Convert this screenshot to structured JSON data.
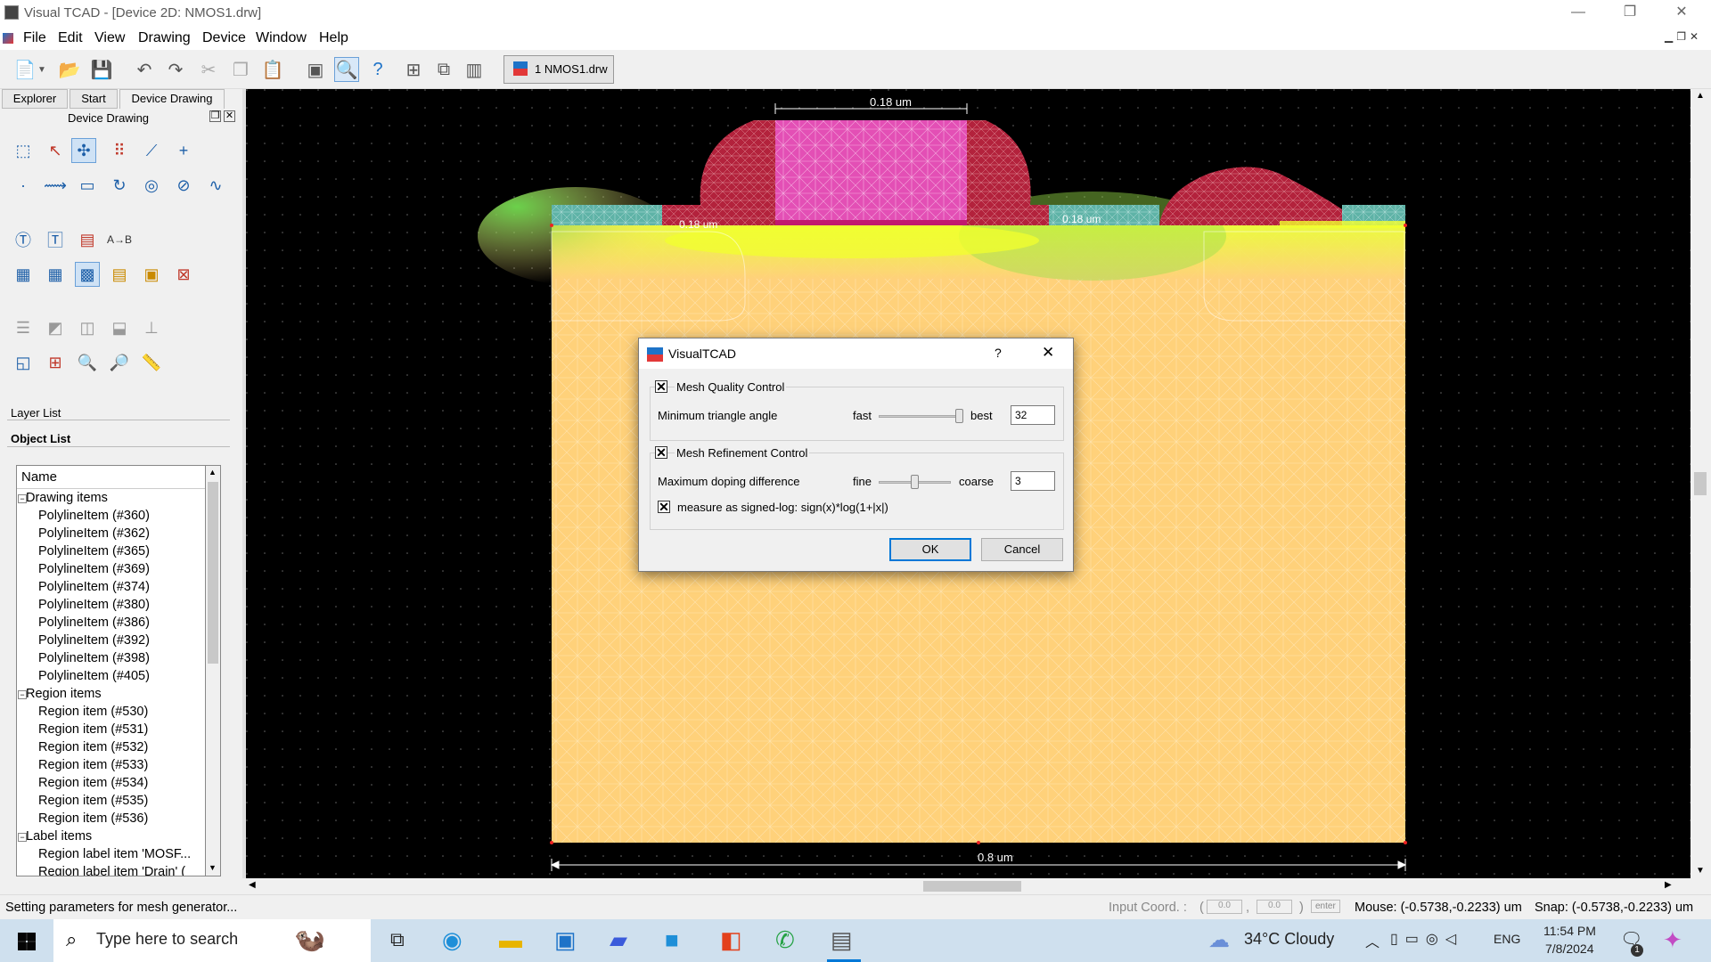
{
  "window": {
    "title": "Visual TCAD - [Device 2D: NMOS1.drw]",
    "controls": {
      "minimize": "—",
      "restore": "❐",
      "close": "✕"
    }
  },
  "menu": [
    "File",
    "Edit",
    "View",
    "Drawing",
    "Device",
    "Window",
    "Help"
  ],
  "toolbar": {
    "doc_tab": "1 NMOS1.drw"
  },
  "left_tabs": [
    "Explorer",
    "Start",
    "Device Drawing"
  ],
  "panel_title": "Device Drawing",
  "sections": {
    "layer_list": "Layer List",
    "object_list": "Object List"
  },
  "tree": {
    "header": "Name",
    "groups": [
      {
        "label": "Drawing items",
        "items": [
          "PolylineItem (#360)",
          "PolylineItem (#362)",
          "PolylineItem (#365)",
          "PolylineItem (#369)",
          "PolylineItem (#374)",
          "PolylineItem (#380)",
          "PolylineItem (#386)",
          "PolylineItem (#392)",
          "PolylineItem (#398)",
          "PolylineItem (#405)"
        ]
      },
      {
        "label": "Region items",
        "items": [
          "Region item (#530)",
          "Region item (#531)",
          "Region item (#532)",
          "Region item (#533)",
          "Region item (#534)",
          "Region item (#535)",
          "Region item (#536)"
        ]
      },
      {
        "label": "Label items",
        "items": [
          "Region label item 'MOSF...",
          "Region label item 'Drain' ("
        ]
      }
    ]
  },
  "canvas": {
    "dims": {
      "top": "0.18 um",
      "bottom": "0.8 um",
      "left_oxide": "0.18 um",
      "right_oxide": "0.18 um"
    }
  },
  "dialog": {
    "title": "VisualTCAD",
    "help": "?",
    "close": "✕",
    "quality": {
      "label": "Mesh Quality Control",
      "checked": true,
      "row_label": "Minimum triangle angle",
      "left": "fast",
      "right": "best",
      "value": "32",
      "slider_fraction": 0.95
    },
    "refine": {
      "label": "Mesh Refinement Control",
      "checked": true,
      "row_label": "Maximum doping difference",
      "left": "fine",
      "right": "coarse",
      "value": "3",
      "slider_fraction": 0.5
    },
    "signed_log": {
      "label": "measure as signed-log: sign(x)*log(1+|x|)",
      "checked": true
    },
    "ok": "OK",
    "cancel": "Cancel"
  },
  "status": {
    "message": "Setting parameters for mesh generator...",
    "input_coord": "Input Coord. :",
    "x": "0.0",
    "y": "0.0",
    "enter": "enter",
    "mouse": "Mouse: (-0.5738,-0.2233) um",
    "snap": "Snap: (-0.5738,-0.2233) um"
  },
  "taskbar": {
    "search": "Type here to search",
    "weather": "34°C  Cloudy",
    "lang": "ENG",
    "time": "11:54 PM",
    "date": "7/8/2024",
    "notif": "1"
  },
  "colors": {
    "substrate": "#ffd17a",
    "poly": "#c1186f",
    "gate": "#e34fb5",
    "oxide": "#5fb3a7",
    "spacer": "#b3223c"
  }
}
